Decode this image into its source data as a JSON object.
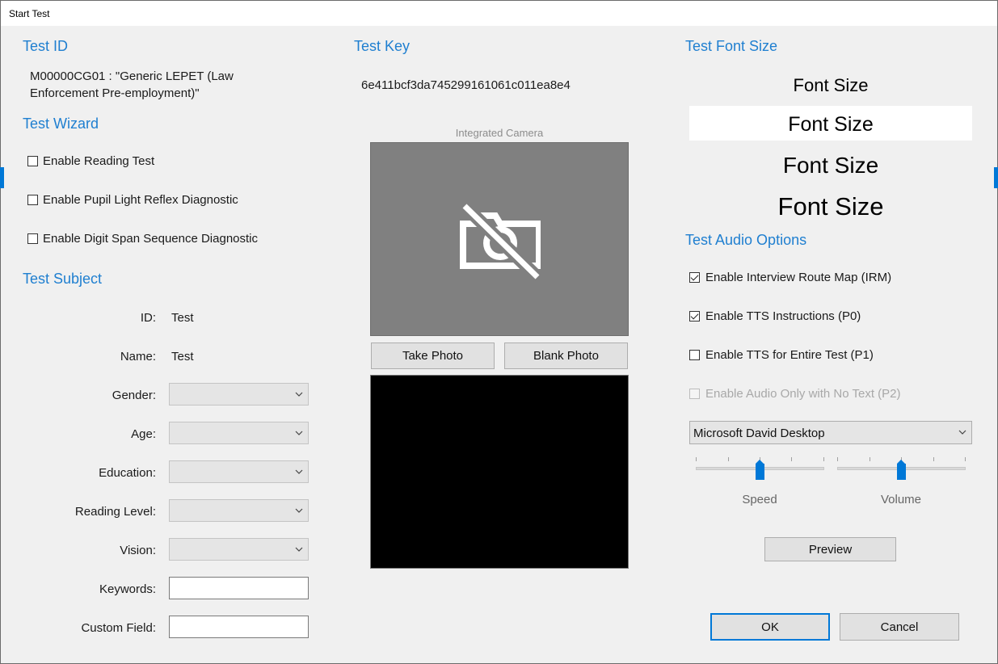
{
  "window": {
    "title": "Start Test"
  },
  "test_id": {
    "heading": "Test ID",
    "line1": "M00000CG01 : \"Generic LEPET (Law",
    "line2": "Enforcement Pre-employment)\""
  },
  "test_key": {
    "heading": "Test Key",
    "value": "6e411bcf3da745299161061c011ea8e4"
  },
  "test_font_size": {
    "heading": "Test Font Size",
    "options": [
      "Font Size",
      "Font Size",
      "Font Size",
      "Font Size"
    ],
    "selected_index": 1
  },
  "test_wizard": {
    "heading": "Test Wizard",
    "items": [
      {
        "label": "Enable Reading Test",
        "checked": false
      },
      {
        "label": "Enable Pupil Light Reflex Diagnostic",
        "checked": false
      },
      {
        "label": "Enable Digit Span Sequence Diagnostic",
        "checked": false
      }
    ]
  },
  "camera": {
    "label": "Integrated Camera",
    "icon": "camera-off-icon",
    "take_photo": "Take Photo",
    "blank_photo": "Blank Photo"
  },
  "test_subject": {
    "heading": "Test Subject",
    "id_label": "ID:",
    "id_value": "Test",
    "name_label": "Name:",
    "name_value": "Test",
    "gender_label": "Gender:",
    "age_label": "Age:",
    "education_label": "Education:",
    "reading_level_label": "Reading Level:",
    "vision_label": "Vision:",
    "keywords_label": "Keywords:",
    "keywords_value": "",
    "custom_field_label": "Custom Field:",
    "custom_field_value": ""
  },
  "audio": {
    "heading": "Test Audio Options",
    "items": [
      {
        "label": "Enable Interview Route Map (IRM)",
        "checked": true,
        "enabled": true
      },
      {
        "label": "Enable TTS Instructions (P0)",
        "checked": true,
        "enabled": true
      },
      {
        "label": "Enable TTS for Entire Test (P1)",
        "checked": false,
        "enabled": true
      },
      {
        "label": "Enable Audio Only with No Text (P2)",
        "checked": false,
        "enabled": false
      }
    ],
    "voice": "Microsoft David Desktop",
    "speed_label": "Speed",
    "speed_level": 0.5,
    "volume_label": "Volume",
    "volume_level": 0.5,
    "preview": "Preview"
  },
  "dialog": {
    "ok": "OK",
    "cancel": "Cancel"
  },
  "colors": {
    "accent": "#1f7fd0",
    "focus": "#0078d7",
    "camera_bg": "#808080",
    "photo_bg": "#000000"
  }
}
